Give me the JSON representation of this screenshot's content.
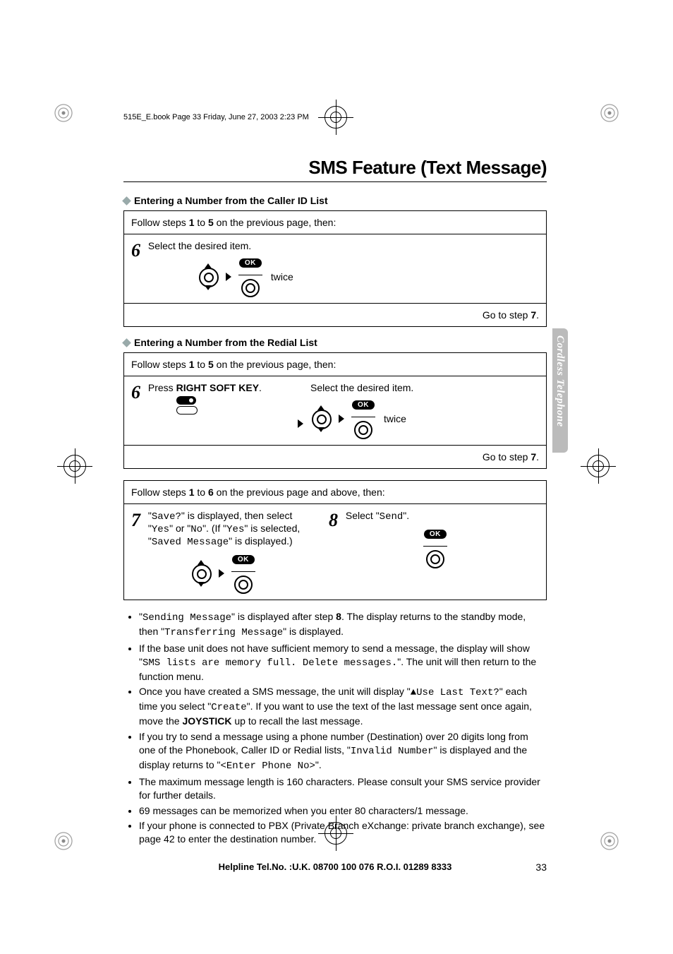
{
  "header_line": "515E_E.book  Page 33  Friday, June 27, 2003  2:23 PM",
  "chapter_title": "SMS Feature (Text Message)",
  "side_tab": "Cordless Telephone",
  "section1": {
    "title": "Entering a Number from the Caller ID List",
    "follow": "Follow steps 1 to 5 on the previous page, then:",
    "step6_num": "6",
    "step6_text": "Select the desired item.",
    "ok": "OK",
    "twice": "twice",
    "goto": "Go to step 7."
  },
  "section2": {
    "title": "Entering a Number from the Redial List",
    "follow": "Follow steps 1 to 5 on the previous page, then:",
    "step6_num": "6",
    "step6_pre": "Press ",
    "step6_bold": "RIGHT SOFT KEY",
    "step6_post": ".",
    "step6b_text": "Select the desired item.",
    "ok": "OK",
    "twice": "twice",
    "goto": "Go to step 7."
  },
  "section3": {
    "follow": "Follow steps 1 to 6 on the previous page and above, then:",
    "step7_num": "7",
    "step7_p1": "\"",
    "step7_m1": "Save?",
    "step7_p2": "\" is displayed, then select \"",
    "step7_m2": "Yes",
    "step7_p3": "\" or \"",
    "step7_m3": "No",
    "step7_p4": "\". (If \"",
    "step7_m4": "Yes",
    "step7_p5": "\" is selected, \"",
    "step7_m5": "Saved Message",
    "step7_p6": "\" is displayed.)",
    "step8_num": "8",
    "step8_p1": "Select \"",
    "step8_m1": "Send",
    "step8_p2": "\".",
    "ok": "OK"
  },
  "bullets": {
    "b1a": "\"",
    "b1m1": "Sending Message",
    "b1b": "\" is displayed after step ",
    "b1bold": "8",
    "b1c": ". The display returns to the standby mode, then \"",
    "b1m2": "Transferring Message",
    "b1d": "\" is displayed.",
    "b2a": "If the base unit does not have sufficient memory to send a message, the display will show \"",
    "b2m": "SMS lists are memory full. Delete messages.",
    "b2b": "\". The unit will then return to the function menu.",
    "b3a": "Once you have created a SMS message, the unit will display \"",
    "b3m": "▲Use Last Text?",
    "b3b": "\" each time you select \"",
    "b3m2": "Create",
    "b3c": "\". If you want to use the text of the last message sent once again, move the ",
    "b3bold": "JOYSTICK",
    "b3d": " up to recall the last message.",
    "b4a": "If you try to send a message using a phone number (Destination) over 20 digits long from one of the Phonebook, Caller ID or Redial lists, \"",
    "b4m1": "Invalid Number",
    "b4b": "\" is displayed and the display returns to \"",
    "b4m2": "<Enter Phone No>",
    "b4c": "\".",
    "b5": "The maximum message length is 160 characters. Please consult your SMS service provider for further details.",
    "b6": "69 messages can be memorized when you enter 80 characters/1 message.",
    "b7": "If your phone is connected to PBX (Private Branch eXchange: private branch exchange), see page 42 to enter the destination number."
  },
  "footer": {
    "helpline": "Helpline Tel.No. :U.K. 08700 100 076  R.O.I. 01289 8333",
    "page_num": "33"
  }
}
